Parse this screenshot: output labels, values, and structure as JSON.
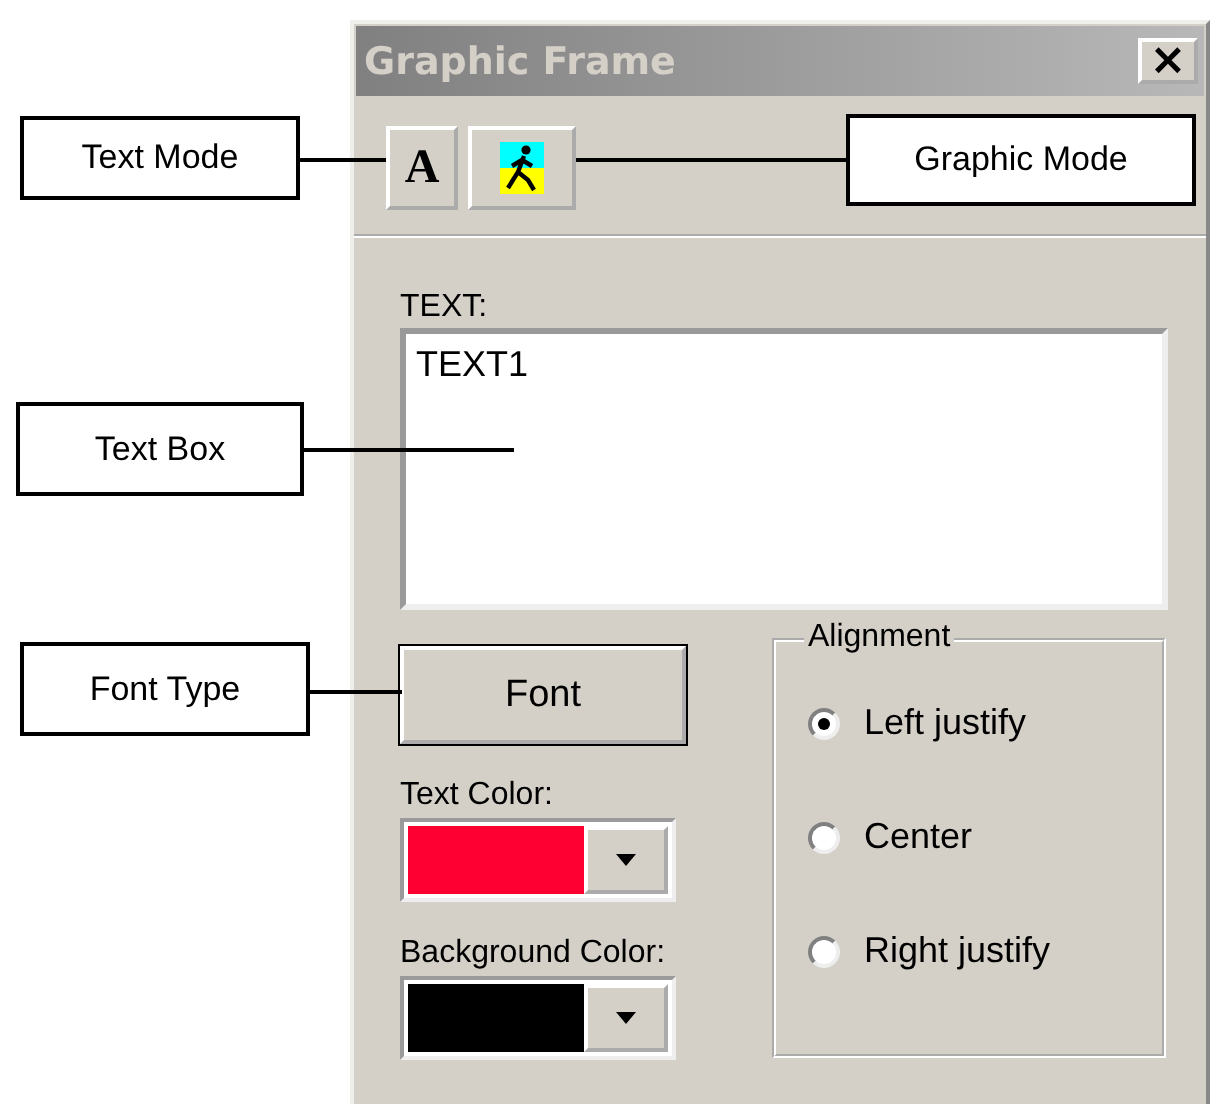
{
  "window": {
    "title": "Graphic Frame",
    "close": "×"
  },
  "toolbar": [
    {
      "kind": "text",
      "label": "A"
    },
    {
      "kind": "graphic"
    }
  ],
  "text": {
    "label": "TEXT:",
    "value": "TEXT1"
  },
  "font_button": "Font",
  "colors": [
    {
      "label": "Text Color:",
      "color": "#ff0033"
    },
    {
      "label": "Background Color:",
      "color": "#000000"
    }
  ],
  "alignment": {
    "title": "Alignment",
    "options": [
      {
        "label": "Left justify",
        "selected": true
      },
      {
        "label": "Center",
        "selected": false
      },
      {
        "label": "Right justify",
        "selected": false
      }
    ]
  },
  "callouts": [
    {
      "label": "Text Mode"
    },
    {
      "label": "Graphic Mode"
    },
    {
      "label": "Text Box"
    },
    {
      "label": "Font Type"
    }
  ]
}
